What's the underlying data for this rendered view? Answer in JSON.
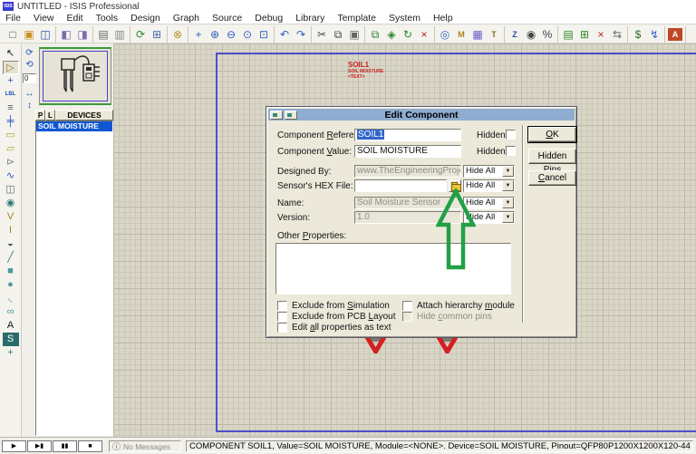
{
  "window": {
    "title": "UNTITLED - ISIS Professional",
    "app_icon_text": "ISIS"
  },
  "menu": {
    "items": [
      "File",
      "View",
      "Edit",
      "Tools",
      "Design",
      "Graph",
      "Source",
      "Debug",
      "Library",
      "Template",
      "System",
      "Help"
    ]
  },
  "toolbar": {
    "groups": [
      [
        {
          "name": "new-file-icon",
          "glyph": "□",
          "color": "#555"
        },
        {
          "name": "open-file-icon",
          "glyph": "▣",
          "color": "#c89020"
        },
        {
          "name": "save-file-icon",
          "glyph": "◫",
          "color": "#2a52a0"
        }
      ],
      [
        {
          "name": "import-section-icon",
          "glyph": "◧",
          "color": "#7a6ab0"
        },
        {
          "name": "export-section-icon",
          "glyph": "◨",
          "color": "#7a6ab0"
        }
      ],
      [
        {
          "name": "print-icon",
          "glyph": "▤",
          "color": "#666"
        },
        {
          "name": "mark-print-area-icon",
          "glyph": "▥",
          "color": "#888"
        }
      ],
      [
        {
          "name": "redraw-icon",
          "glyph": "⟳",
          "color": "#2a8a2a"
        },
        {
          "name": "toggle-grid-icon",
          "glyph": "⊞",
          "color": "#4a6ab0"
        }
      ],
      [
        {
          "name": "origin-icon",
          "glyph": "⊗",
          "color": "#b09020"
        }
      ],
      [
        {
          "name": "pan-icon",
          "glyph": "+",
          "color": "#3060c0"
        },
        {
          "name": "zoom-in-icon",
          "glyph": "⊕",
          "color": "#3060c0"
        },
        {
          "name": "zoom-out-icon",
          "glyph": "⊖",
          "color": "#3060c0"
        },
        {
          "name": "zoom-all-icon",
          "glyph": "⊙",
          "color": "#3060c0"
        },
        {
          "name": "zoom-area-icon",
          "glyph": "⊡",
          "color": "#3060c0"
        }
      ],
      [
        {
          "name": "undo-icon",
          "glyph": "↶",
          "color": "#3060c0"
        },
        {
          "name": "redo-icon",
          "glyph": "↷",
          "color": "#3060c0"
        }
      ],
      [
        {
          "name": "cut-icon",
          "glyph": "✂",
          "color": "#444"
        },
        {
          "name": "copy-icon",
          "glyph": "⧉",
          "color": "#444"
        },
        {
          "name": "paste-icon",
          "glyph": "▣",
          "color": "#666"
        }
      ],
      [
        {
          "name": "block-copy-icon",
          "glyph": "⧉",
          "color": "#2a8a2a"
        },
        {
          "name": "block-move-icon",
          "glyph": "◈",
          "color": "#2a8a2a"
        },
        {
          "name": "block-rotate-icon",
          "glyph": "↻",
          "color": "#2a8a2a"
        },
        {
          "name": "block-delete-icon",
          "glyph": "×",
          "color": "#c02020"
        }
      ],
      [
        {
          "name": "pick-parts-icon",
          "glyph": "◎",
          "color": "#3060c0"
        },
        {
          "name": "make-device-icon",
          "glyph": "M",
          "color": "#b08020",
          "boxed": true
        },
        {
          "name": "packaging-tool-icon",
          "glyph": "▦",
          "color": "#6a5acd"
        },
        {
          "name": "decompose-icon",
          "glyph": "T",
          "color": "#8a6a20",
          "boxed": true
        }
      ],
      [
        {
          "name": "wire-autorouter-icon",
          "glyph": "Z",
          "color": "#2a52a0",
          "boxed": true
        },
        {
          "name": "search-and-tag-icon",
          "glyph": "◉",
          "color": "#444"
        },
        {
          "name": "property-assignment-icon",
          "glyph": "%",
          "color": "#445"
        }
      ],
      [
        {
          "name": "design-explorer-icon",
          "glyph": "▤",
          "color": "#2a8a2a"
        },
        {
          "name": "new-sheet-icon",
          "glyph": "⊞",
          "color": "#2a8a2a"
        },
        {
          "name": "remove-sheet-icon",
          "glyph": "×",
          "color": "#c02020"
        },
        {
          "name": "goto-sheet-icon",
          "glyph": "⇆",
          "color": "#666"
        }
      ],
      [
        {
          "name": "bill-of-materials-icon",
          "glyph": "$",
          "color": "#2a6a2a"
        },
        {
          "name": "electrical-rule-check-icon",
          "glyph": "↯",
          "color": "#3060c0"
        }
      ],
      [
        {
          "name": "netlist-to-ares-icon",
          "glyph": "A",
          "color": "#fff",
          "bg": "#c04828",
          "boxed": true
        }
      ]
    ]
  },
  "left_toolbar": {
    "tools": [
      {
        "name": "selection-mode-icon",
        "glyph": "↖",
        "color": "#111"
      },
      {
        "name": "component-mode-icon",
        "glyph": "▷",
        "color": "#8a7a20",
        "selected": true
      },
      {
        "name": "junction-dot-mode-icon",
        "glyph": "+",
        "color": "#2050c0"
      },
      {
        "name": "wire-label-mode-icon",
        "glyph": "LBL",
        "color": "#2050c0",
        "small": true
      },
      {
        "name": "text-script-mode-icon",
        "glyph": "≡",
        "color": "#555"
      },
      {
        "name": "bus-mode-icon",
        "glyph": "╪",
        "color": "#2050c0"
      },
      {
        "name": "subcircuit-mode-icon",
        "glyph": "▭",
        "color": "#b0a020"
      },
      {
        "name": "terminal-mode-icon",
        "glyph": "▱",
        "color": "#b0a020"
      },
      {
        "name": "device-pin-mode-icon",
        "glyph": "⊳",
        "color": "#888"
      },
      {
        "name": "graph-mode-icon",
        "glyph": "∿",
        "color": "#2050c0"
      },
      {
        "name": "tape-recorder-mode-icon",
        "glyph": "◫",
        "color": "#666"
      },
      {
        "name": "generator-mode-icon",
        "glyph": "◉",
        "color": "#2a7a7a"
      },
      {
        "name": "voltage-probe-mode-icon",
        "glyph": "V",
        "color": "#a08020",
        "small": false
      },
      {
        "name": "current-probe-mode-icon",
        "glyph": "I",
        "color": "#a08020"
      },
      {
        "name": "virtual-instruments-mode-icon",
        "glyph": "◒",
        "color": "#555"
      },
      {
        "name": "graphics-line-mode-icon",
        "glyph": "╱",
        "color": "#2a7a7a"
      },
      {
        "name": "graphics-box-mode-icon",
        "glyph": "■",
        "color": "#4a9a9a"
      },
      {
        "name": "graphics-circle-mode-icon",
        "glyph": "●",
        "color": "#4a9a9a"
      },
      {
        "name": "graphics-arc-mode-icon",
        "glyph": "◟",
        "color": "#4a9a9a"
      },
      {
        "name": "graphics-path-mode-icon",
        "glyph": "∞",
        "color": "#4a9a9a"
      },
      {
        "name": "graphics-text-mode-icon",
        "glyph": "A",
        "color": "#111"
      },
      {
        "name": "graphics-symbol-mode-icon",
        "glyph": "S",
        "color": "#fff",
        "bg": "#2a6a6a",
        "boxed": true
      },
      {
        "name": "marker-mode-icon",
        "glyph": "+",
        "color": "#2a7a7a"
      }
    ]
  },
  "object_selector": {
    "rotate_cw": "⟳",
    "rotate_ccw": "⟲",
    "angle_value": "0",
    "mirror_h": "↔",
    "mirror_v": "↕",
    "p_button": "P",
    "l_button": "L",
    "header": "DEVICES",
    "devices": [
      {
        "label": "SOIL MOISTURE",
        "selected": true
      }
    ]
  },
  "schematic": {
    "component_ref": "SOIL1",
    "component_value": "SOIL MOISTURE",
    "component_text": "<TEXT>"
  },
  "dialog": {
    "title": "Edit Component",
    "rows": {
      "component_reference": {
        "label": "Component &Reference:",
        "value": "SOIL1",
        "hidden_label": "Hidden:"
      },
      "component_value": {
        "label": "Component &Value:",
        "value": "SOIL MOISTURE",
        "hidden_label": "Hidden:"
      },
      "designed_by": {
        "label": "Designed By:",
        "value": "www.TheEngineeringProjects.com",
        "visibility": "Hide All"
      },
      "hex_file": {
        "label": "Sensor's HEX File:",
        "value": "",
        "visibility": "Hide All"
      },
      "name": {
        "label": "Name:",
        "value": "Soil Moisture Sensor",
        "visibility": "Hide All"
      },
      "version": {
        "label": "Version:",
        "value": "1.0",
        "visibility": "Hide All"
      },
      "other_properties": {
        "label": "Other &Properties:",
        "value": ""
      }
    },
    "dropdown_arrow": "▼",
    "checkboxes": {
      "exclude_simulation": "Exclude from &Simulation",
      "exclude_pcb": "Exclude from PCB &Layout",
      "edit_all_text": "Edit &all properties as text",
      "attach_hierarchy": "Attach hierarchy &module",
      "hide_common_pins": "Hide &common pins"
    },
    "buttons": {
      "ok": "&OK",
      "hidden_pins": "Hidden &Pins",
      "cancel": "&Cancel"
    }
  },
  "status_bar": {
    "playback": [
      {
        "name": "play-button",
        "glyph": "▶"
      },
      {
        "name": "step-button",
        "glyph": "▶▮"
      },
      {
        "name": "pause-button",
        "glyph": "▮▮"
      },
      {
        "name": "stop-button",
        "glyph": "■"
      }
    ],
    "info_icon": "ⓘ",
    "no_messages": "No Messages",
    "message": "COMPONENT SOIL1, Value=SOIL MOISTURE, Module=<NONE>. Device=SOIL MOISTURE, Pinout=QFP80P1200X1200X120-44"
  },
  "colors": {
    "selection": "#3166c8",
    "device_selected": "#1157d2",
    "sheet_border": "#5050c8",
    "annotation_green": "#23a046",
    "schematic_red": "#cc2020"
  }
}
